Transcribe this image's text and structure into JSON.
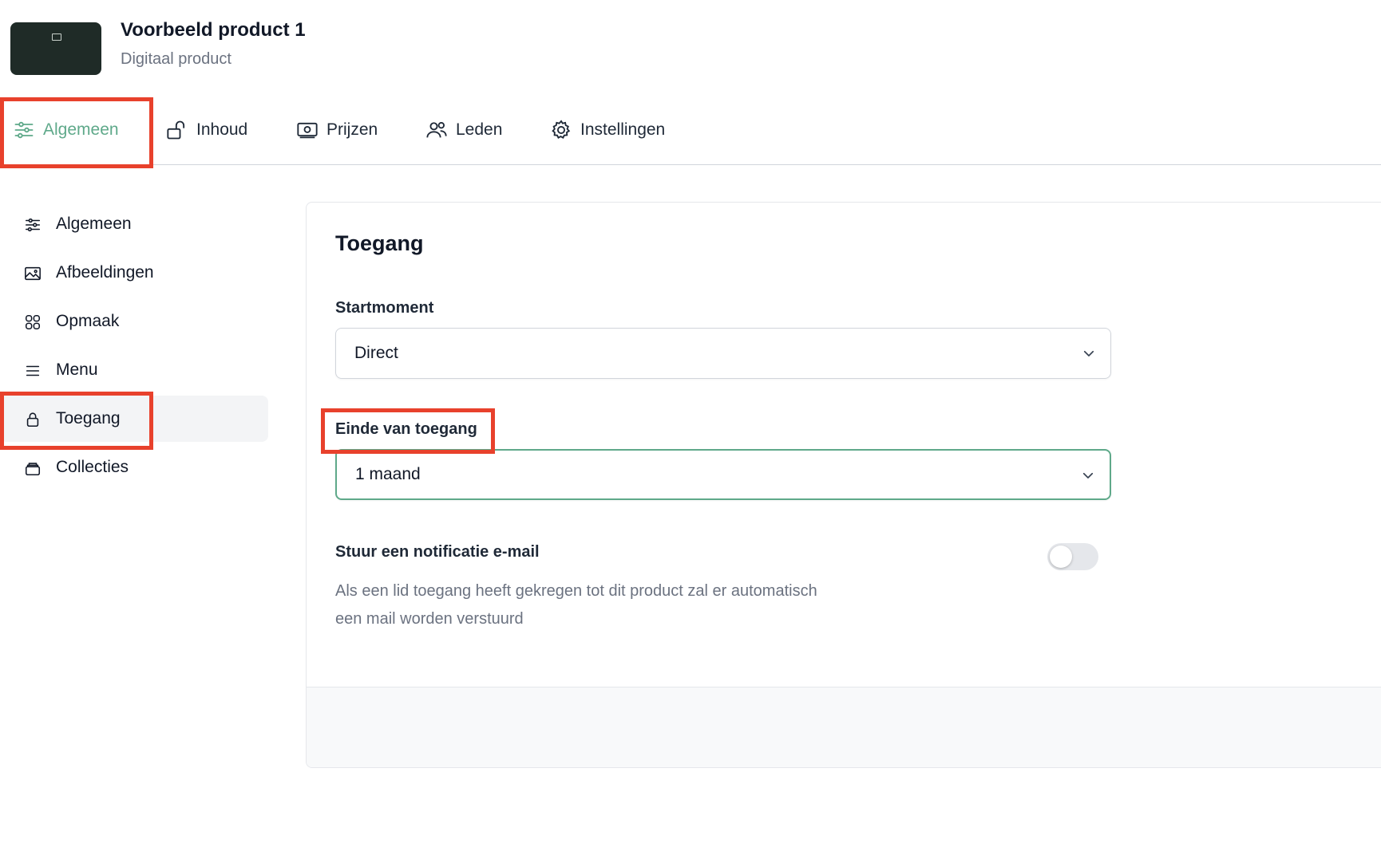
{
  "product": {
    "title": "Voorbeeld product 1",
    "subtitle": "Digitaal product"
  },
  "tabs": [
    {
      "label": "Algemeen",
      "icon": "sliders-icon",
      "active": true
    },
    {
      "label": "Inhoud",
      "icon": "unlock-icon"
    },
    {
      "label": "Prijzen",
      "icon": "banknote-icon"
    },
    {
      "label": "Leden",
      "icon": "users-icon"
    },
    {
      "label": "Instellingen",
      "icon": "gear-icon"
    }
  ],
  "sidebar": {
    "items": [
      {
        "label": "Algemeen",
        "icon": "sliders-icon"
      },
      {
        "label": "Afbeeldingen",
        "icon": "image-icon"
      },
      {
        "label": "Opmaak",
        "icon": "grid-icon"
      },
      {
        "label": "Menu",
        "icon": "menu-icon"
      },
      {
        "label": "Toegang",
        "icon": "lock-icon",
        "active": true
      },
      {
        "label": "Collecties",
        "icon": "collection-icon"
      }
    ]
  },
  "main": {
    "heading": "Toegang",
    "startmoment": {
      "label": "Startmoment",
      "value": "Direct"
    },
    "einde": {
      "label": "Einde van toegang",
      "value": "1 maand"
    },
    "notification": {
      "title": "Stuur een notificatie e-mail",
      "description": "Als een lid toegang heeft gekregen tot dit product zal er automatisch een mail worden verstuurd",
      "enabled": false
    }
  },
  "colors": {
    "accent": "#5fa98a",
    "highlight": "#e8412c"
  }
}
